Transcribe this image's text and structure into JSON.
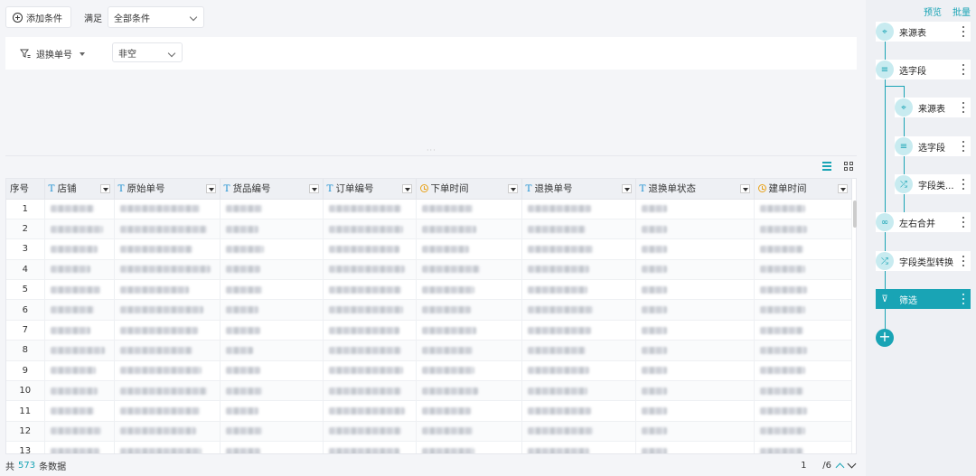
{
  "toolbar": {
    "add_condition_label": "添加条件",
    "satisfy_label": "满足",
    "match_select_value": "全部条件"
  },
  "condition": {
    "field_label": "退换单号",
    "operator_value": "非空"
  },
  "table": {
    "columns": [
      {
        "label": "序号",
        "type": "index"
      },
      {
        "label": "店铺",
        "type": "text"
      },
      {
        "label": "原始单号",
        "type": "text"
      },
      {
        "label": "货品编号",
        "type": "text"
      },
      {
        "label": "订单编号",
        "type": "text"
      },
      {
        "label": "下单时间",
        "type": "datetime"
      },
      {
        "label": "退换单号",
        "type": "text"
      },
      {
        "label": "退换单状态",
        "type": "text"
      },
      {
        "label": "建单时间",
        "type": "datetime"
      }
    ],
    "row_numbers": [
      "1",
      "2",
      "3",
      "4",
      "5",
      "6",
      "7",
      "8",
      "9",
      "10",
      "11",
      "12",
      "13"
    ]
  },
  "footer": {
    "total_prefix": "共",
    "total_count": "573",
    "total_suffix": "条数据",
    "current_page": "1",
    "total_pages": "/6"
  },
  "flow": {
    "preview_label": "预览",
    "batch_label": "批量",
    "nodes": [
      {
        "label": "来源表",
        "icon": "source-icon",
        "glyph": "⌖"
      },
      {
        "label": "选字段",
        "icon": "select-fields-icon",
        "glyph": "≡"
      },
      {
        "label": "来源表",
        "icon": "source-icon",
        "glyph": "⌖"
      },
      {
        "label": "选字段",
        "icon": "select-fields-icon",
        "glyph": "≡"
      },
      {
        "label": "字段类...",
        "icon": "shuffle-icon",
        "glyph": "⤮"
      },
      {
        "label": "左右合并",
        "icon": "merge-icon",
        "glyph": "∞"
      },
      {
        "label": "字段类型转换",
        "icon": "shuffle-icon",
        "glyph": "⤮"
      },
      {
        "label": "筛选",
        "icon": "filter-icon",
        "glyph": "⊽"
      }
    ],
    "add_glyph": "+"
  },
  "colors": {
    "accent": "#19a4b5",
    "time_icon": "#e9a31a",
    "text_type_icon": "#1a8fd1"
  }
}
